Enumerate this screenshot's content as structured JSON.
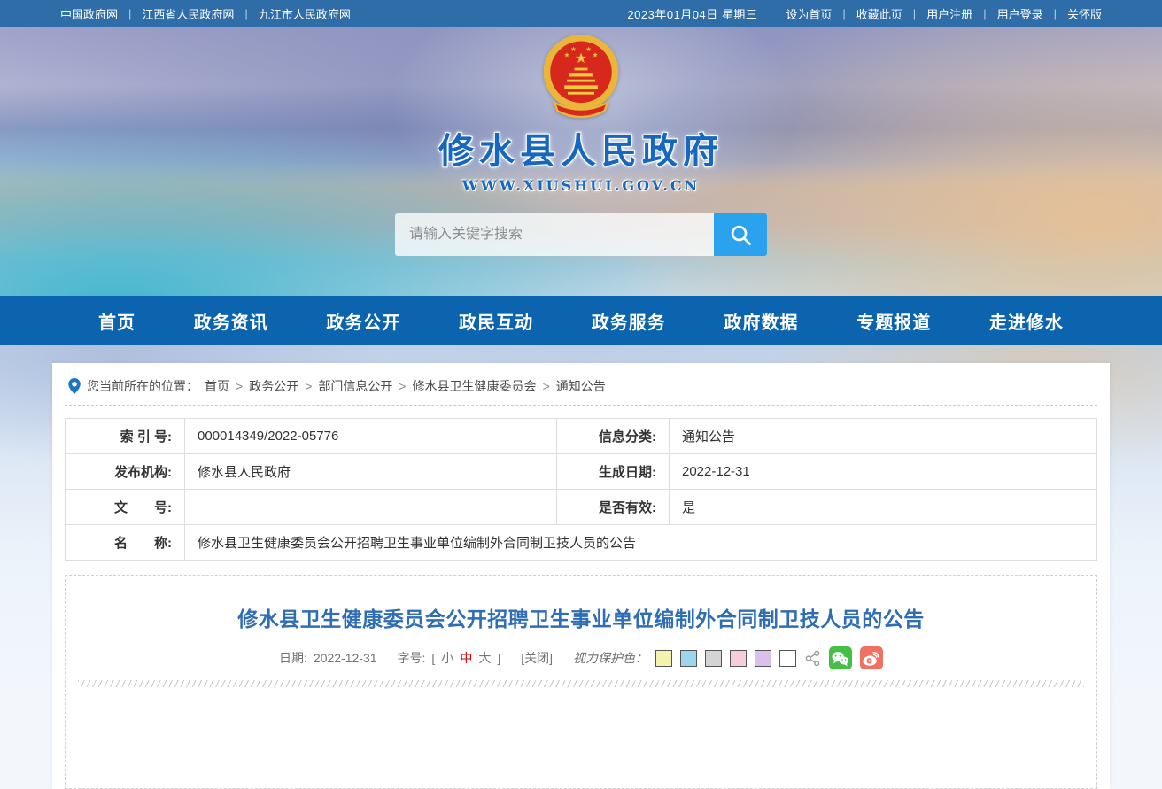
{
  "colors": {
    "topbar_bg": "#2f6da8",
    "nav_bg": "#0c64ae",
    "site_title_blue": "#1667bf",
    "search_button_bg": "#2aa2ee",
    "article_title_blue": "#2f6db5",
    "font_medium_red": "#d40000",
    "wechat_green": "#45c045",
    "weibo_red": "#ef7163",
    "protect_colors": [
      "#f5f1ae",
      "#9cd6ee",
      "#d4d4d4",
      "#f7cddb",
      "#d9c1ec",
      "#ffffff"
    ]
  },
  "topbar": {
    "links": [
      "中国政府网",
      "江西省人民政府网",
      "九江市人民政府网"
    ],
    "separator": "|",
    "date": "2023年01月04日 星期三",
    "actions": [
      "设为首页",
      "收藏此页",
      "用户注册",
      "用户登录",
      "关怀版"
    ]
  },
  "banner": {
    "site_title": "修水县人民政府",
    "site_url": "WWW.XIUSHUI.GOV.CN",
    "search_placeholder": "请输入关键字搜索"
  },
  "nav": {
    "items": [
      "首页",
      "政务资讯",
      "政务公开",
      "政民互动",
      "政务服务",
      "政府数据",
      "专题报道",
      "走进修水"
    ]
  },
  "breadcrumb": {
    "prefix": "您当前所在的位置：",
    "separator": ">",
    "items": [
      "首页",
      "政务公开",
      "部门信息公开",
      "修水县卫生健康委员会",
      "通知公告"
    ]
  },
  "info_table": {
    "rows": [
      {
        "c0l": "索 引 号:",
        "c0v": "000014349/2022-05776",
        "c1l": "信息分类:",
        "c1v": "通知公告"
      },
      {
        "c0l": "发布机构:",
        "c0v": "修水县人民政府",
        "c1l": "生成日期:",
        "c1v": "2022-12-31"
      },
      {
        "c0l": "文　　号:",
        "c0v": "",
        "c1l": "是否有效:",
        "c1v": "是"
      },
      {
        "full_label": "名　　称:",
        "full_value": "修水县卫生健康委员会公开招聘卫生事业单位编制外合同制卫技人员的公告"
      }
    ]
  },
  "article": {
    "title": "修水县卫生健康委员会公开招聘卫生事业单位编制外合同制卫技人员的公告",
    "meta": {
      "date_label": "日期:",
      "date_value": "2022-12-31",
      "font_label": "字号:",
      "bracket_open": "[",
      "font_small": "小",
      "font_medium": "中",
      "font_large": "大",
      "bracket_close": "]",
      "close_button": "[关闭]",
      "protect_label": "视力保护色："
    },
    "icons": {
      "share": "share-nodes-icon",
      "wechat": "wechat-icon",
      "weibo": "weibo-icon"
    }
  }
}
